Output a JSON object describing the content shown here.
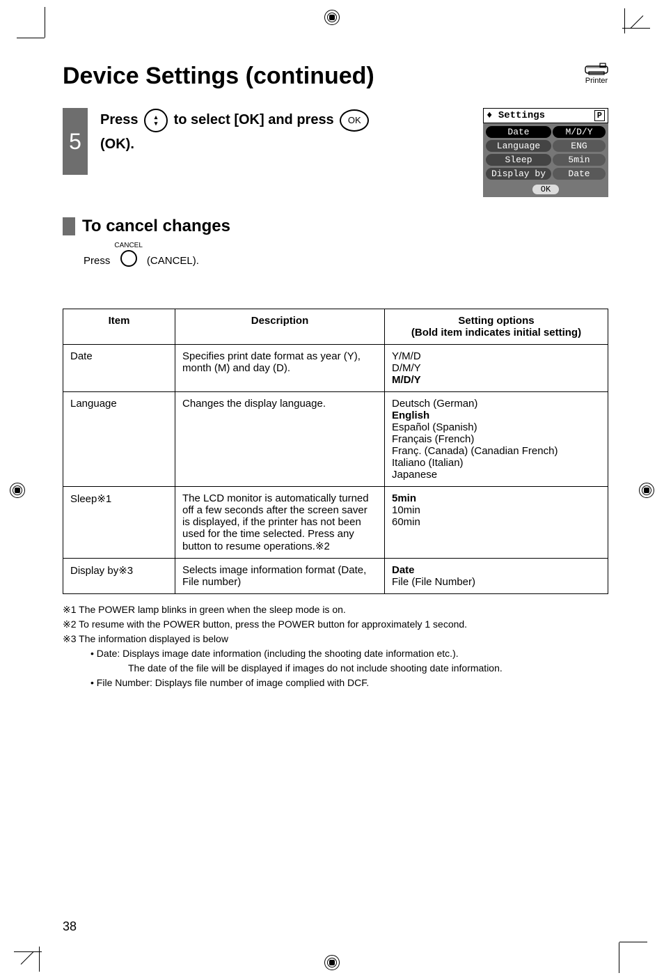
{
  "title": "Device Settings (continued)",
  "printer_label": "Printer",
  "step": {
    "number": "5",
    "text_prefix": "Press ",
    "text_mid": " to select [OK] and press ",
    "text_suffix": " (OK).",
    "ok_glyph": "OK",
    "arrow_up": "▴",
    "arrow_down": "▾"
  },
  "lcd": {
    "head_icon": "♦",
    "head_title": "Settings",
    "head_p": "P",
    "rows": [
      {
        "label": "Date",
        "value": "M/D/Y",
        "active": true
      },
      {
        "label": "Language",
        "value": "ENG",
        "active": false
      },
      {
        "label": "Sleep",
        "value": "5min",
        "active": false
      },
      {
        "label": "Display by",
        "value": "Date",
        "active": false
      }
    ],
    "foot": "OK"
  },
  "cancel": {
    "heading": "To cancel changes",
    "press": "Press",
    "label": "CANCEL",
    "after": "(CANCEL)."
  },
  "table": {
    "headers": {
      "item": "Item",
      "description": "Description",
      "options": "Setting options\n(Bold item indicates initial setting)"
    },
    "rows": [
      {
        "item": "Date",
        "description": "Specifies print date format as year (Y), month (M) and day (D).",
        "options_plain": "Y/M/D\nD/M/Y",
        "options_bold": "M/D/Y"
      },
      {
        "item": "Language",
        "description": "Changes the display language.",
        "options_plain_before": "Deutsch (German)",
        "options_bold": "English",
        "options_plain_after": "Español (Spanish)\nFrançais (French)\nFranç. (Canada) (Canadian French)\nItaliano (Italian)\nJapanese"
      },
      {
        "item": "Sleep※1",
        "description": "The LCD monitor is automatically turned off a few seconds after the screen saver is displayed, if the printer has not been used for the time selected. Press any button to resume operations.※2",
        "options_bold": "5min",
        "options_plain_after": "10min\n60min"
      },
      {
        "item": "Display by※3",
        "description": "Selects image information format (Date, File number)",
        "options_bold": "Date",
        "options_plain_after": "File (File Number)"
      }
    ]
  },
  "notes": {
    "n1": "※1 The POWER lamp blinks in green when the sleep mode is on.",
    "n2": "※2 To resume with the POWER button, press the POWER button for approximately 1 second.",
    "n3": "※3 The information displayed is below",
    "n3a": "• Date: Displays image date information (including the shooting date information etc.).",
    "n3a1": "The date of the file will be displayed if images do not include shooting date information.",
    "n3b": "• File Number: Displays file number of image complied with DCF."
  },
  "page_number": "38"
}
